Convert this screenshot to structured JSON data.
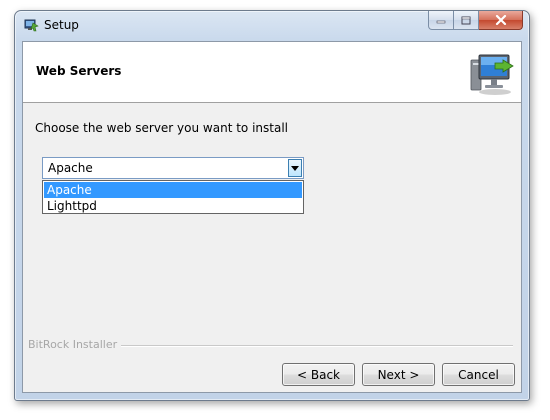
{
  "window": {
    "title": "Setup"
  },
  "header": {
    "title": "Web Servers"
  },
  "main": {
    "prompt": "Choose the web server you want to install",
    "web_server_select": {
      "selected": "Apache",
      "options": [
        "Apache",
        "Lighttpd"
      ],
      "highlighted_index": 0
    }
  },
  "footer": {
    "branding": "BitRock Installer",
    "buttons": {
      "back": "< Back",
      "next": "Next >",
      "cancel": "Cancel"
    }
  },
  "colors": {
    "selection": "#3399ff",
    "close_button": "#c4492f"
  },
  "icons": [
    "setup-app-icon",
    "minimize-icon",
    "maximize-icon",
    "close-icon",
    "dropdown-arrow-icon",
    "computer-install-icon"
  ]
}
